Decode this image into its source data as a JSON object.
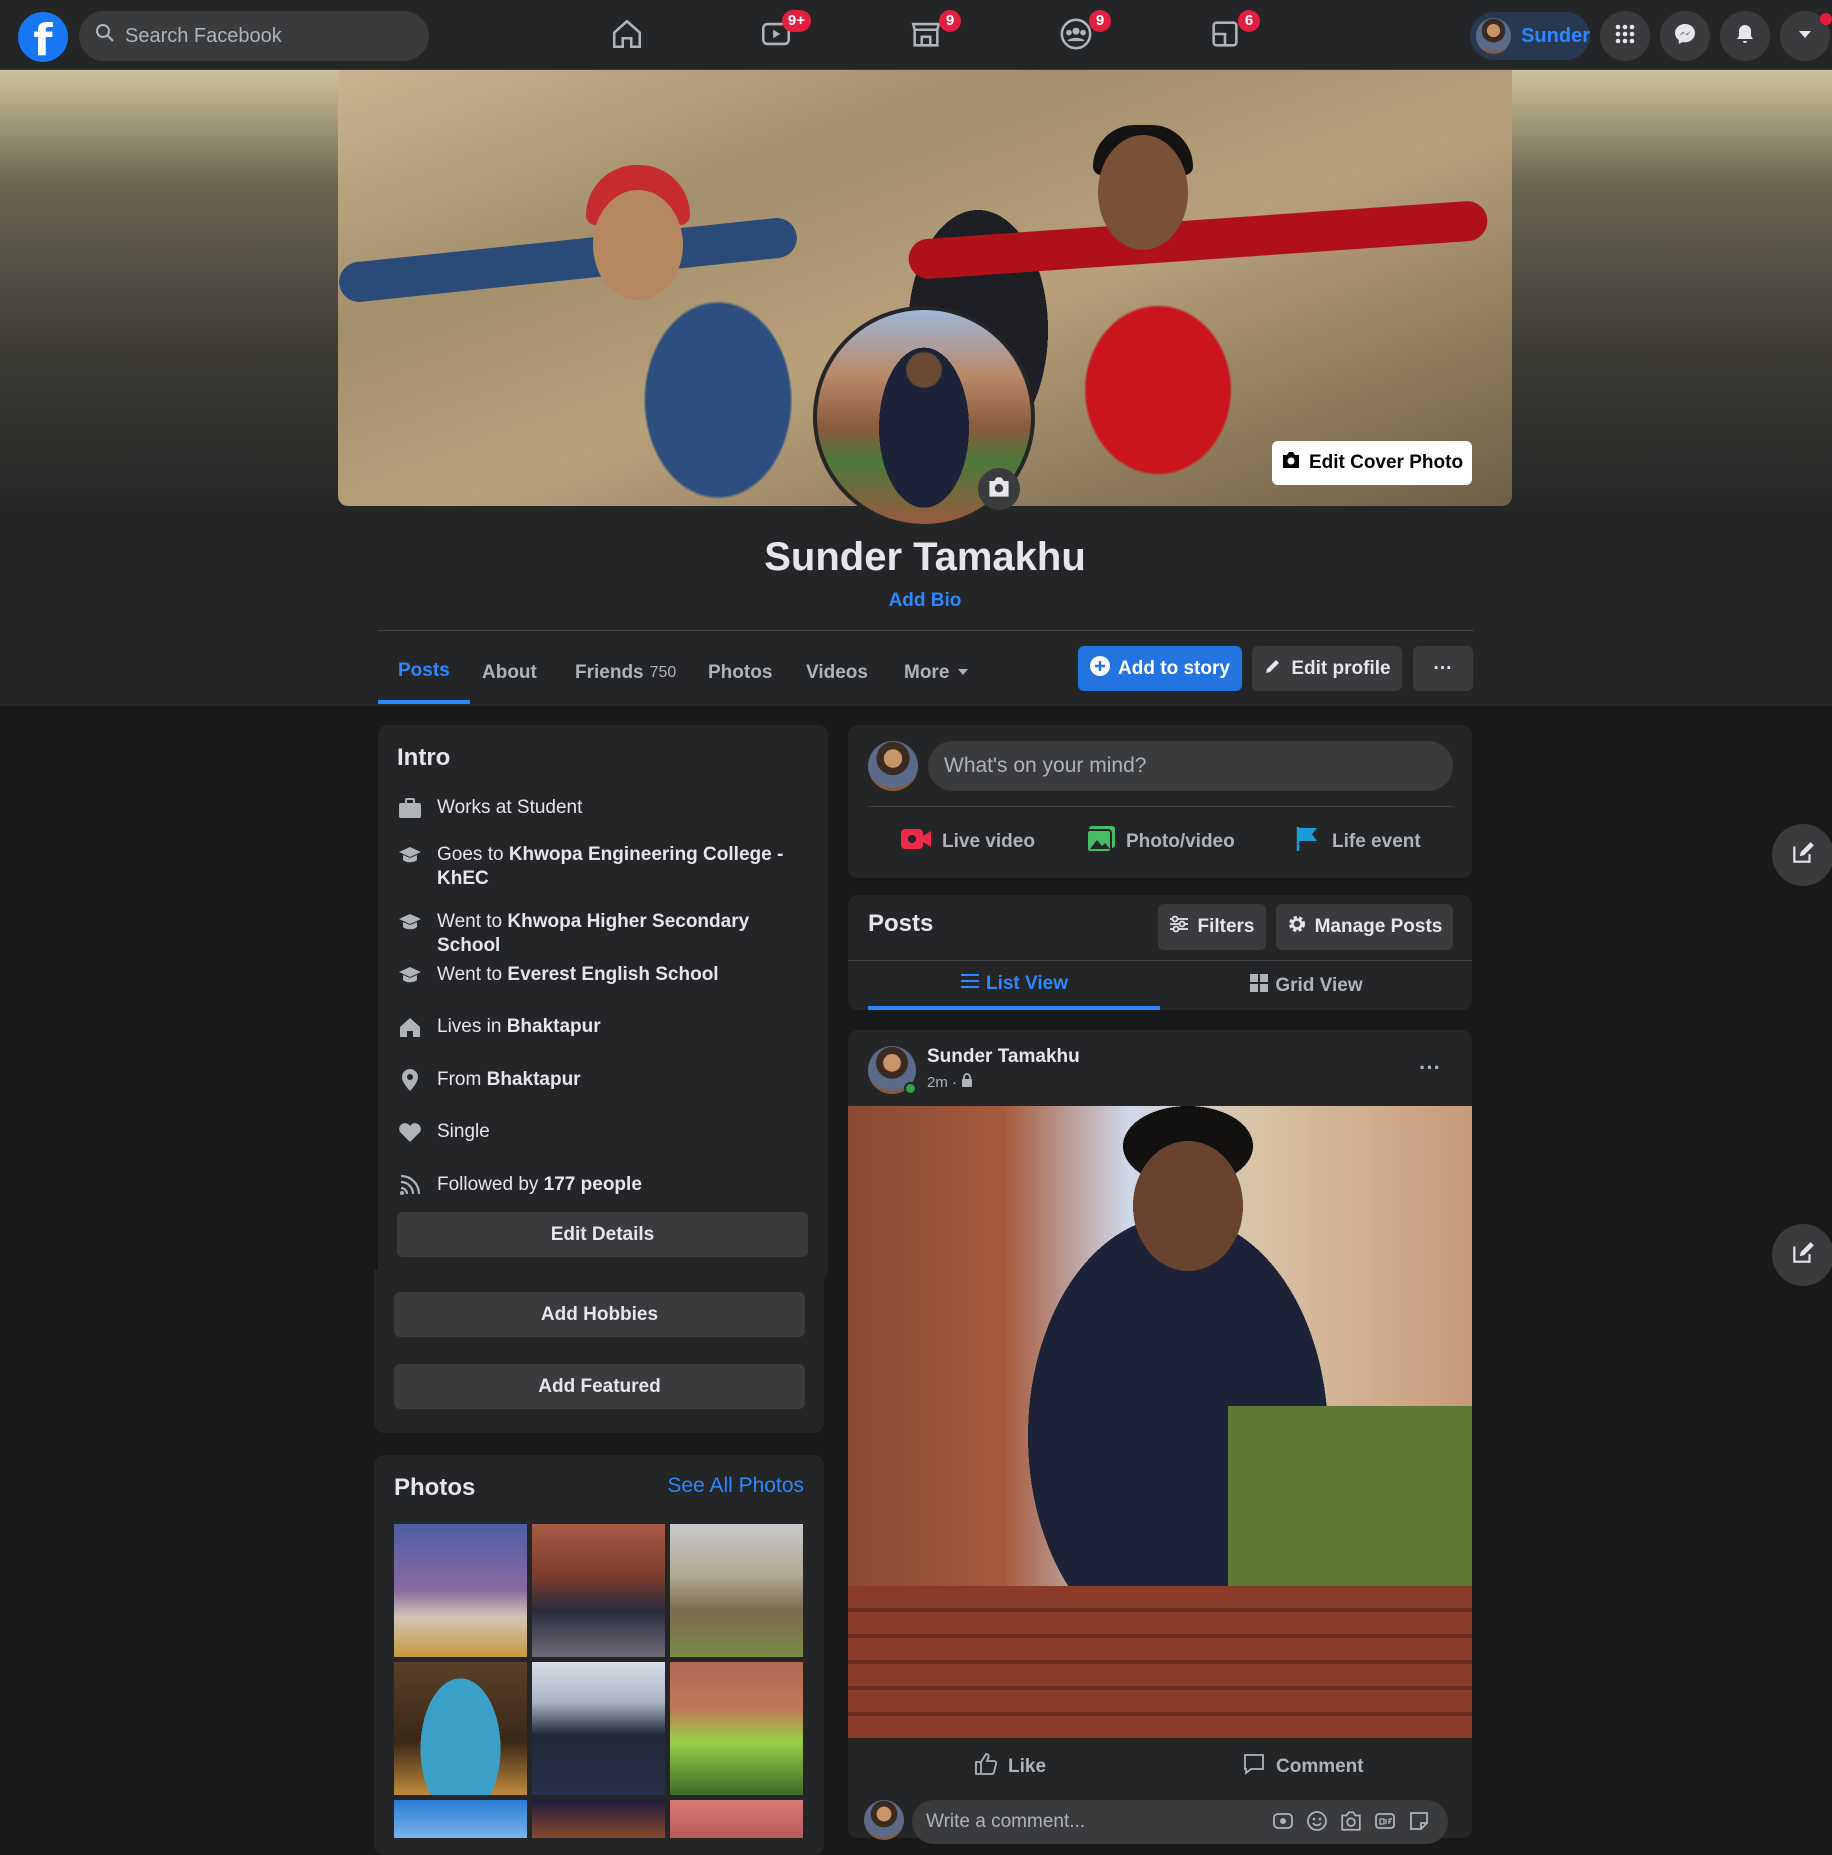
{
  "topbar": {
    "search_placeholder": "Search Facebook",
    "logo_letter": "f",
    "nav": [
      {
        "name": "home",
        "badge": ""
      },
      {
        "name": "watch",
        "badge": "9+"
      },
      {
        "name": "marketplace",
        "badge": "9"
      },
      {
        "name": "groups",
        "badge": "9"
      },
      {
        "name": "gaming",
        "badge": "6"
      }
    ],
    "user_name": "Sunder"
  },
  "profile": {
    "name": "Sunder Tamakhu",
    "add_bio": "Add Bio",
    "edit_cover": "Edit Cover Photo"
  },
  "tabs": {
    "posts": "Posts",
    "about": "About",
    "friends": "Friends",
    "friends_count": "750",
    "photos": "Photos",
    "videos": "Videos",
    "more": "More"
  },
  "actions": {
    "add_story": "Add to story",
    "edit_profile": "Edit profile",
    "more_dots": "···"
  },
  "intro": {
    "title": "Intro",
    "works_prefix": "Works at ",
    "works": "Student",
    "goes_prefix": "Goes to ",
    "goes": "Khwopa Engineering College - KhEC",
    "went1_prefix": "Went to ",
    "went1": "Khwopa Higher Secondary School",
    "went2_prefix": "Went to ",
    "went2": "Everest English School",
    "lives_prefix": "Lives in ",
    "lives": "Bhaktapur",
    "from_prefix": "From ",
    "from": "Bhaktapur",
    "relationship": "Single",
    "followed_prefix": "Followed by ",
    "followed": "177 people",
    "edit_details": "Edit Details",
    "add_hobbies": "Add Hobbies",
    "add_featured": "Add Featured"
  },
  "photos": {
    "title": "Photos",
    "see_all": "See All Photos"
  },
  "composer": {
    "placeholder": "What's on your mind?",
    "live_video": "Live video",
    "photo_video": "Photo/video",
    "life_event": "Life event"
  },
  "posts_section": {
    "title": "Posts",
    "filters": "Filters",
    "manage": "Manage Posts",
    "list_view": "List View",
    "grid_view": "Grid View"
  },
  "post": {
    "author": "Sunder Tamakhu",
    "time": "2m · ",
    "like": "Like",
    "comment": "Comment",
    "comment_placeholder": "Write a comment..."
  },
  "colors": {
    "accent": "#2d88ff",
    "brand": "#1877f2",
    "badge": "#e41e3f",
    "bg": "#18191a",
    "card": "#242526"
  }
}
